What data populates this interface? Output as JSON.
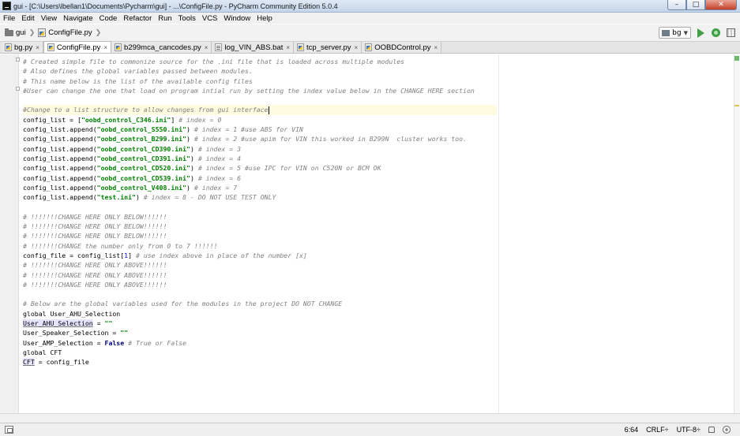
{
  "window": {
    "title": "gui - [C:\\Users\\lbellan1\\Documents\\Pycharm\\gui] - ...\\ConfigFile.py - PyCharm Community Edition 5.0.4",
    "controls": {
      "minimize": "–",
      "maximize": "□",
      "close": "✕"
    }
  },
  "menu": [
    "File",
    "Edit",
    "View",
    "Navigate",
    "Code",
    "Refactor",
    "Run",
    "Tools",
    "VCS",
    "Window",
    "Help"
  ],
  "breadcrumb": {
    "project": "gui",
    "file": "ConfigFile.py"
  },
  "toolbar": {
    "run_config": "bg"
  },
  "tabs": [
    {
      "label": "bg.py",
      "type": "py",
      "active": false
    },
    {
      "label": "ConfigFile.py",
      "type": "py",
      "active": true
    },
    {
      "label": "b299mca_cancodes.py",
      "type": "py",
      "active": false
    },
    {
      "label": "log_VIN_ABS.bat",
      "type": "bat",
      "active": false
    },
    {
      "label": "tcp_server.py",
      "type": "py",
      "active": false
    },
    {
      "label": "OOBDControl.py",
      "type": "py",
      "active": false
    }
  ],
  "tab_close_glyph": "×",
  "code": [
    [
      [
        "cm",
        "# Created simple file to commonize source for the .ini file that is loaded across multiple modules"
      ]
    ],
    [
      [
        "cm",
        "# Also defines the global variables passed between modules."
      ]
    ],
    [
      [
        "cm",
        "# This name below is the list of the available config files"
      ]
    ],
    [
      [
        "cm",
        "#User can change the one that load on program intial run by setting the index value below in the CHANGE HERE section"
      ]
    ],
    [],
    [
      [
        "cm",
        "#Change to a list structure to allow changes from gui interface"
      ],
      [
        "caret",
        ""
      ]
    ],
    [
      [
        "tx",
        "config_list = ["
      ],
      [
        "st",
        "\"oobd_control_C346.ini\""
      ],
      [
        "tx",
        "] "
      ],
      [
        "cm",
        "# index = 0"
      ]
    ],
    [
      [
        "tx",
        "config_list.append("
      ],
      [
        "st",
        "\"oobd_control_S550.ini\""
      ],
      [
        "tx",
        ") "
      ],
      [
        "cm",
        "# index = 1 #use ABS for VIN"
      ]
    ],
    [
      [
        "tx",
        "config_list.append("
      ],
      [
        "st",
        "\"oobd_control_B299.ini\""
      ],
      [
        "tx",
        ") "
      ],
      [
        "cm",
        "# index = 2 #use apim for VIN this worked in B299N  cluster works too."
      ]
    ],
    [
      [
        "tx",
        "config_list.append("
      ],
      [
        "st",
        "\"oobd_control_CD390.ini\""
      ],
      [
        "tx",
        ") "
      ],
      [
        "cm",
        "# index = 3"
      ]
    ],
    [
      [
        "tx",
        "config_list.append("
      ],
      [
        "st",
        "\"oobd_control_CD391.ini\""
      ],
      [
        "tx",
        ") "
      ],
      [
        "cm",
        "# index = 4"
      ]
    ],
    [
      [
        "tx",
        "config_list.append("
      ],
      [
        "st",
        "\"oobd_control_CD520.ini\""
      ],
      [
        "tx",
        ") "
      ],
      [
        "cm",
        "# index = 5 #use IPC for VIN on C520N or BCM OK"
      ]
    ],
    [
      [
        "tx",
        "config_list.append("
      ],
      [
        "st",
        "\"oobd_control_CD539.ini\""
      ],
      [
        "tx",
        ") "
      ],
      [
        "cm",
        "# index = 6"
      ]
    ],
    [
      [
        "tx",
        "config_list.append("
      ],
      [
        "st",
        "\"oobd_control_V408.ini\""
      ],
      [
        "tx",
        ") "
      ],
      [
        "cm",
        "# index = 7"
      ]
    ],
    [
      [
        "tx",
        "config_list.append("
      ],
      [
        "st",
        "\"test.ini\""
      ],
      [
        "tx",
        ") "
      ],
      [
        "cm",
        "# index = 8 - DO NOT USE TEST ONLY"
      ]
    ],
    [],
    [
      [
        "cm",
        "# !!!!!!!CHANGE HERE ONLY BELOW!!!!!!"
      ]
    ],
    [
      [
        "cm",
        "# !!!!!!!CHANGE HERE ONLY BELOW!!!!!!"
      ]
    ],
    [
      [
        "cm",
        "# !!!!!!!CHANGE HERE ONLY BELOW!!!!!!"
      ]
    ],
    [
      [
        "cm",
        "# !!!!!!!CHANGE the number only from 0 to 7 !!!!!!"
      ]
    ],
    [
      [
        "tx",
        "config_file = config_list["
      ],
      [
        "nm",
        "1"
      ],
      [
        "tx",
        "] "
      ],
      [
        "cm",
        "# use index above in place of the number [x]"
      ]
    ],
    [
      [
        "cm",
        "# !!!!!!!CHANGE HERE ONLY ABOVE!!!!!!"
      ]
    ],
    [
      [
        "cm",
        "# !!!!!!!CHANGE HERE ONLY ABOVE!!!!!!"
      ]
    ],
    [
      [
        "cm",
        "# !!!!!!!CHANGE HERE ONLY ABOVE!!!!!!"
      ]
    ],
    [],
    [
      [
        "cm",
        "# Below are the global variables used for the modules in the project DO NOT CHANGE"
      ]
    ],
    [
      [
        "tx",
        "global User_AHU_Selection"
      ]
    ],
    [
      [
        "hl",
        "User_AHU_Selection"
      ],
      [
        "tx",
        " = "
      ],
      [
        "st",
        "\"\""
      ]
    ],
    [
      [
        "tx",
        "User_Speaker_Selection = "
      ],
      [
        "st",
        "\"\""
      ]
    ],
    [
      [
        "tx",
        "User_AMP_Selection = "
      ],
      [
        "kw",
        "False"
      ],
      [
        "tx",
        " "
      ],
      [
        "cm",
        "# True or False"
      ]
    ],
    [
      [
        "tx",
        "global CFT"
      ]
    ],
    [
      [
        "hl",
        "CFT"
      ],
      [
        "tx",
        " = config_file"
      ]
    ]
  ],
  "status": {
    "position": "6:64",
    "line_separator": "CRLF÷",
    "encoding": "UTF-8÷"
  }
}
